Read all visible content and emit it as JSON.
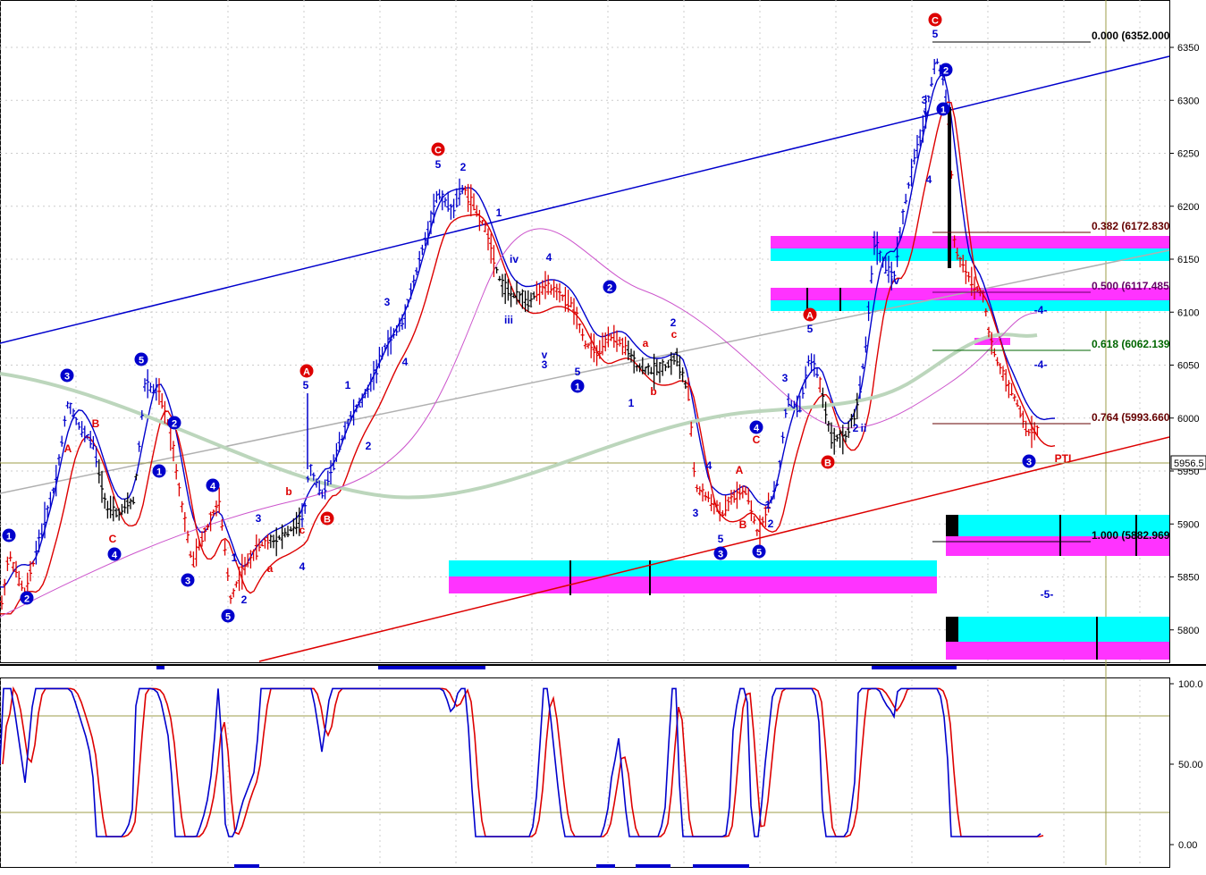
{
  "colors": {
    "background": "#ffffff",
    "grid": "#cccccc",
    "blue": "#0000cc",
    "red": "#dd0000",
    "black": "#000000",
    "magenta": "#ff33ff",
    "cyan": "#00ffff",
    "ma_slow": "#bcd6bc",
    "ma_mid": "#b0b0b0",
    "ma_purple": "#cc55cc",
    "stoch_level": "#9c9c4a",
    "fib_label": "#000000",
    "fib_500": "#660066",
    "fib_618": "#006600",
    "fib_382": "#660000"
  },
  "chart_data": [
    {
      "type": "candlestick",
      "panel": "price",
      "y_ticks": [
        "6350",
        "6300",
        "6250",
        "6200",
        "6150",
        "6100",
        "6050",
        "6000",
        "5950",
        "5900",
        "5850",
        "5800"
      ],
      "ylim": [
        5770,
        6380
      ],
      "current_price_label": "5956.5",
      "grid": true,
      "fib_levels": [
        {
          "ratio": "0.000",
          "text": "0.000 (6352.000",
          "value": 6352.0
        },
        {
          "ratio": "0.382",
          "text": "0.382 (6172.830",
          "value": 6172.83
        },
        {
          "ratio": "0.500",
          "text": "0.500 (6117.485",
          "value": 6117.49
        },
        {
          "ratio": "0.618",
          "text": "0.618 (6062.139",
          "value": 6062.14
        },
        {
          "ratio": "0.764",
          "text": "0.764 (5993.660",
          "value": 5993.66
        },
        {
          "ratio": "1.000",
          "text": "1.000 (5882.969",
          "value": 5882.97
        }
      ],
      "wave_labels": [
        "3",
        "5",
        "A",
        "C",
        "2",
        "5",
        "C",
        "3",
        "5",
        "3",
        "4",
        "5",
        "1",
        "2",
        "3",
        "4",
        "5",
        "A",
        "B",
        "C",
        "1",
        "2",
        "3",
        "4",
        "5",
        "iii",
        "iv",
        "v",
        "i",
        "ii",
        "PTI",
        "-5-",
        "-4-"
      ],
      "series": [
        {
          "name": "price",
          "values_note": "OHLC bars: blue = up-trend segments, red = down-trend segments, black = corrective"
        }
      ]
    },
    {
      "type": "line",
      "panel": "stochastic",
      "y_ticks": [
        "100.0",
        "50.00",
        "0.00"
      ],
      "ylim": [
        0,
        100
      ],
      "levels": [
        80,
        20
      ]
    }
  ]
}
